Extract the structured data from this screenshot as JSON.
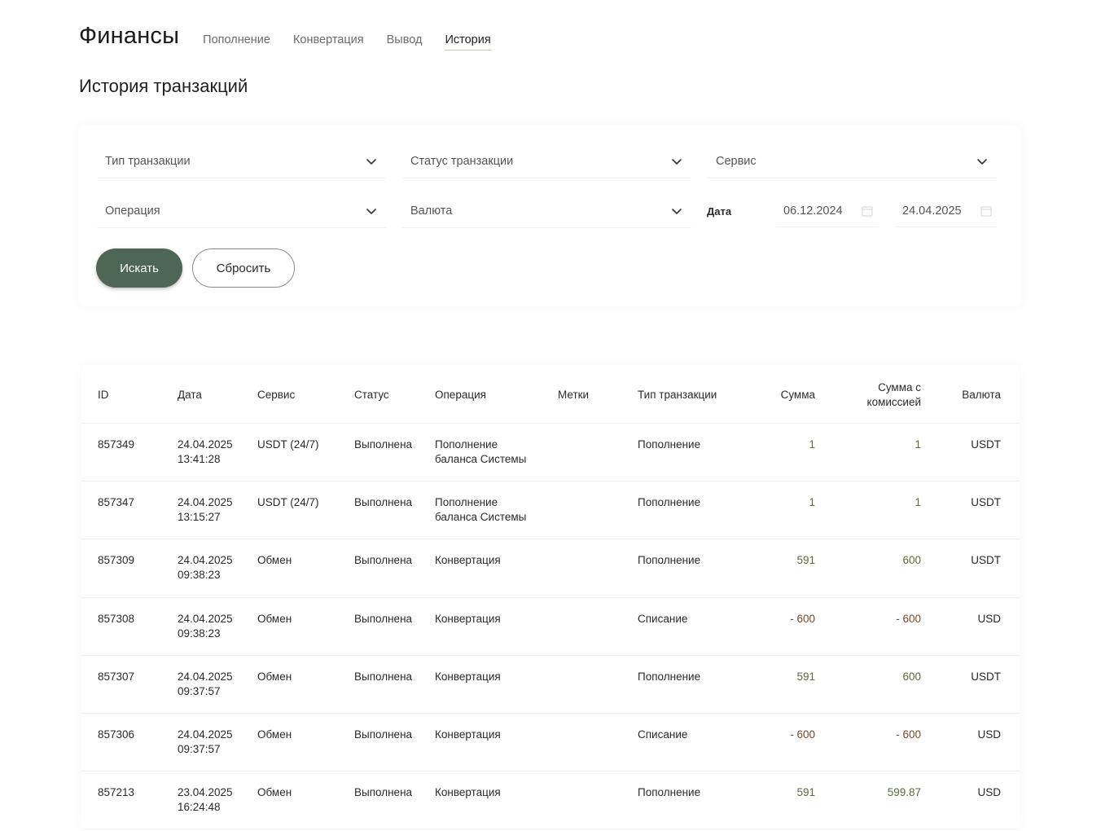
{
  "header": {
    "title": "Финансы",
    "tabs": [
      {
        "label": "Пополнение",
        "active": false
      },
      {
        "label": "Конвертация",
        "active": false
      },
      {
        "label": "Вывод",
        "active": false
      },
      {
        "label": "История",
        "active": true
      }
    ]
  },
  "section_title": "История транзакций",
  "filters": {
    "transaction_type": "Тип транзакции",
    "transaction_status": "Статус транзакции",
    "service": "Сервис",
    "operation": "Операция",
    "currency": "Валюта",
    "date_label": "Дата",
    "date_from": "06.12.2024",
    "date_to": "24.04.2025",
    "search_button": "Искать",
    "reset_button": "Сбросить"
  },
  "table": {
    "columns": {
      "id": "ID",
      "date": "Дата",
      "service": "Сервис",
      "status": "Статус",
      "operation": "Операция",
      "tags": "Метки",
      "type": "Тип транзакции",
      "amount": "Сумма",
      "amount_fee": "Сумма с\nкомиссией",
      "currency": "Валюта"
    },
    "rows": [
      {
        "id": "857349",
        "date": "24.04.2025\n13:41:28",
        "service": "USDT (24/7)",
        "status": "Выполнена",
        "operation": "Пополнение\nбаланса Системы",
        "tags": "",
        "type": "Пополнение",
        "amount": "1",
        "amount_fee": "1",
        "currency": "USDT"
      },
      {
        "id": "857347",
        "date": "24.04.2025\n13:15:27",
        "service": "USDT (24/7)",
        "status": "Выполнена",
        "operation": "Пополнение\nбаланса Системы",
        "tags": "",
        "type": "Пополнение",
        "amount": "1",
        "amount_fee": "1",
        "currency": "USDT"
      },
      {
        "id": "857309",
        "date": "24.04.2025\n09:38:23",
        "service": "Обмен",
        "status": "Выполнена",
        "operation": "Конвертация",
        "tags": "",
        "type": "Пополнение",
        "amount": "591",
        "amount_fee": "600",
        "currency": "USDT"
      },
      {
        "id": "857308",
        "date": "24.04.2025\n09:38:23",
        "service": "Обмен",
        "status": "Выполнена",
        "operation": "Конвертация",
        "tags": "",
        "type": "Списание",
        "amount": "- 600",
        "amount_fee": "- 600",
        "currency": "USD"
      },
      {
        "id": "857307",
        "date": "24.04.2025\n09:37:57",
        "service": "Обмен",
        "status": "Выполнена",
        "operation": "Конвертация",
        "tags": "",
        "type": "Пополнение",
        "amount": "591",
        "amount_fee": "600",
        "currency": "USDT"
      },
      {
        "id": "857306",
        "date": "24.04.2025\n09:37:57",
        "service": "Обмен",
        "status": "Выполнена",
        "operation": "Конвертация",
        "tags": "",
        "type": "Списание",
        "amount": "- 600",
        "amount_fee": "- 600",
        "currency": "USD"
      },
      {
        "id": "857213",
        "date": "23.04.2025\n16:24:48",
        "service": "Обмен",
        "status": "Выполнена",
        "operation": "Конвертация",
        "tags": "",
        "type": "Пополнение",
        "amount": "591",
        "amount_fee": "599.87",
        "currency": "USD"
      }
    ]
  },
  "colors": {
    "accent": "#4e6656",
    "negative_amount": "#7a4a2a",
    "positive_amount": "#5a6a3a",
    "active_tab_underline": "#c8c9a6"
  }
}
